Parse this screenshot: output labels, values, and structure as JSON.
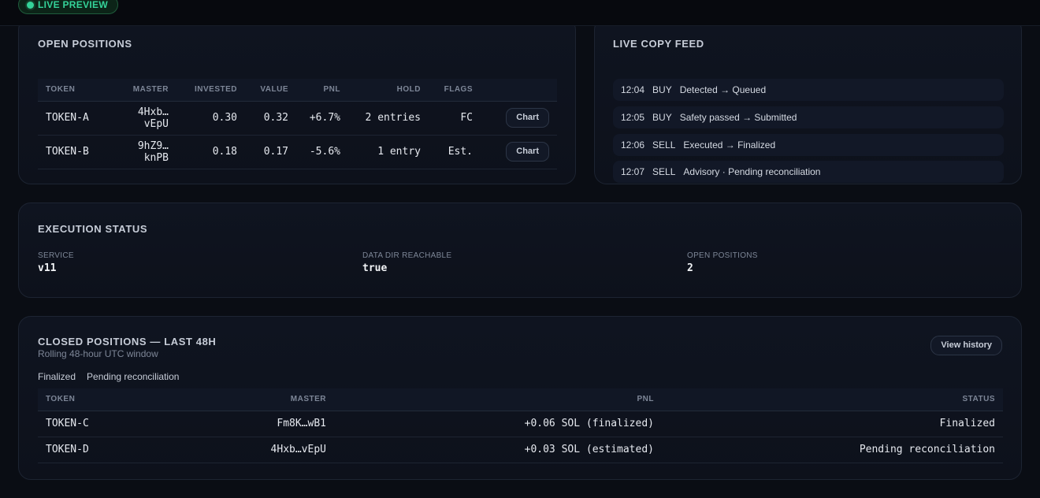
{
  "header": {
    "live_label": "LIVE PREVIEW"
  },
  "open_positions": {
    "title": "OPEN POSITIONS",
    "columns": [
      "TOKEN",
      "MASTER",
      "INVESTED",
      "VALUE",
      "PNL",
      "HOLD",
      "FLAGS"
    ],
    "rows": [
      {
        "token": "TOKEN-A",
        "master": "4Hxb…vEpU",
        "invested": "0.30",
        "value": "0.32",
        "pnl": "+6.7%",
        "hold": "2 entries",
        "flags": "FC",
        "action": "Chart"
      },
      {
        "token": "TOKEN-B",
        "master": "9hZ9…knPB",
        "invested": "0.18",
        "value": "0.17",
        "pnl": "-5.6%",
        "hold": "1 entry",
        "flags": "Est.",
        "action": "Chart"
      }
    ]
  },
  "copy_feed": {
    "title": "LIVE COPY FEED",
    "items": [
      {
        "time": "12:04",
        "side": "BUY",
        "status": "Detected → Queued"
      },
      {
        "time": "12:05",
        "side": "BUY",
        "status": "Safety passed → Submitted"
      },
      {
        "time": "12:06",
        "side": "SELL",
        "status": "Executed → Finalized"
      },
      {
        "time": "12:07",
        "side": "SELL",
        "status": "Advisory · Pending reconciliation"
      }
    ]
  },
  "execution_status": {
    "title": "EXECUTION STATUS",
    "stats": [
      {
        "label": "SERVICE",
        "value": "v11"
      },
      {
        "label": "DATA DIR REACHABLE",
        "value": "true"
      },
      {
        "label": "OPEN POSITIONS",
        "value": "2"
      }
    ]
  },
  "closed_positions": {
    "title": "CLOSED POSITIONS — LAST 48H",
    "subtitle": "Rolling 48-hour UTC window",
    "view_label": "View history",
    "legend": [
      "Finalized",
      "Pending reconciliation"
    ],
    "columns": [
      "TOKEN",
      "MASTER",
      "PNL",
      "STATUS"
    ],
    "rows": [
      {
        "token": "TOKEN-C",
        "master": "Fm8K…wB1",
        "pnl": "+0.06 SOL (finalized)",
        "status": "Finalized"
      },
      {
        "token": "TOKEN-D",
        "master": "4Hxb…vEpU",
        "pnl": "+0.03 SOL (estimated)",
        "status": "Pending reconciliation"
      }
    ]
  },
  "colors": {
    "positive": "#34d399",
    "negative": "#f05252",
    "accent": "#34d399"
  }
}
